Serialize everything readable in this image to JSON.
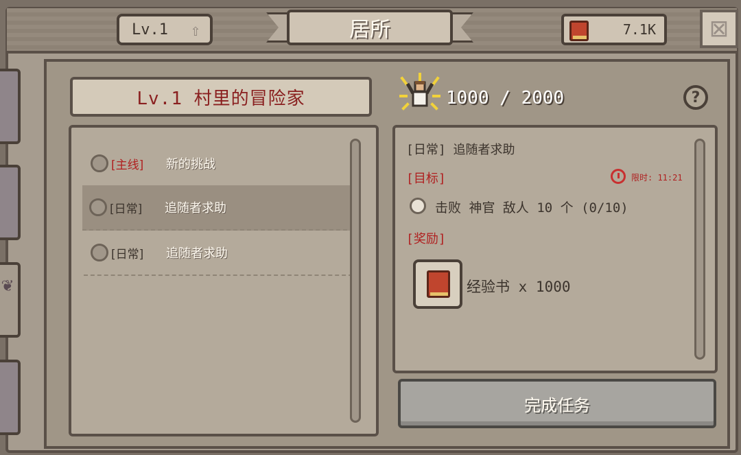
{
  "header": {
    "level": "Lv.1",
    "title": "居所",
    "currency_value": "7.1K"
  },
  "rank": {
    "title": "Lv.1 村里的冒险家"
  },
  "progress": {
    "current": "1000",
    "separator": "/",
    "max": "2000",
    "text": "1000 / 2000"
  },
  "help_label": "?",
  "quests": [
    {
      "tag": "[主线]",
      "name": "新的挑战",
      "type": "main",
      "selected": false
    },
    {
      "tag": "[日常]",
      "name": "追随者求助",
      "type": "daily",
      "selected": true
    },
    {
      "tag": "[日常]",
      "name": "追随者求助",
      "type": "daily",
      "selected": false
    }
  ],
  "detail": {
    "title": "[日常] 追随者求助",
    "goal_label": "[目标]",
    "timer": "限时: 11:21",
    "objective": "击败 神官 敌人 10 个 (0/10)",
    "reward_label": "[奖励]",
    "reward_text": "经验书 x 1000"
  },
  "complete_button": "完成任务",
  "icons": {
    "level_up": "up-arrow-icon",
    "currency": "exp-book-icon",
    "close": "close-icon",
    "trophy": "cheering-hero-icon",
    "timer": "alarm-clock-icon",
    "reward": "exp-book-icon"
  },
  "colors": {
    "accent_red": "#b02020",
    "panel": "#b4aa9b",
    "button_disabled": "#a7a5a0"
  }
}
